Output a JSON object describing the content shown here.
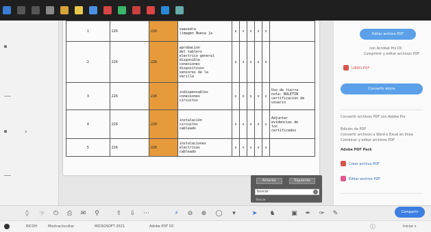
{
  "taskbar": {
    "icons": [
      "windows-icon",
      "search-icon",
      "task-view-icon",
      "app-icon",
      "app-icon",
      "folder-icon",
      "app-icon",
      "app-icon",
      "chrome-icon",
      "app-icon",
      "app-icon",
      "app-icon",
      "app-icon"
    ],
    "colors": [
      "#3a7bd5",
      "#555555",
      "#555555",
      "#888888",
      "#d6a23a",
      "#e8c84a",
      "#4a90e2",
      "#d64545",
      "#3bb56b",
      "#c94040",
      "#d44",
      "#2a8ad8",
      "#6aa"
    ]
  },
  "table": {
    "rows": [
      {
        "num": "1",
        "code": "226",
        "mid": "226",
        "desc": "saavedra\n(imagen Nueva [a",
        "marks": [
          "x",
          "x",
          "x",
          "x",
          "x"
        ],
        "note": ""
      },
      {
        "num": "2",
        "code": "226",
        "mid": "226",
        "desc": "aprobación\ndel tablero\nelectrico general\ndisponible\nconexiones\ndispositivos\nsensores de la\nvarilla",
        "marks": [
          "x",
          "x",
          "x",
          "x",
          "x"
        ],
        "note": ""
      },
      {
        "num": "3",
        "code": "226",
        "mid": "226",
        "desc": "indispensables\nconexiones\ncircuitos",
        "marks": [
          "x",
          "x",
          "x",
          "x",
          "x"
        ],
        "note": "Uso de tierra\nnota: BOLETIN\ncertificación de\nusuario"
      },
      {
        "num": "4",
        "code": "226",
        "mid": "226",
        "desc": "instalación\ncircuitos\ncableado",
        "marks": [
          "x",
          "x",
          "x",
          "x",
          "x"
        ],
        "note": "Adjuntar\nevidencias de\nlos\ncertificados"
      },
      {
        "num": "5",
        "code": "226",
        "mid": "226",
        "desc": "instalaciones\nelectricas\ncableado",
        "marks": [
          "x",
          "x",
          "x",
          "x",
          "x"
        ],
        "note": ""
      }
    ]
  },
  "popup": {
    "btn_left": "Anterior",
    "btn_right": "Siguiente",
    "input_value": "buscar",
    "footer": "Buscar"
  },
  "right_panel": {
    "top_button": "Editar archivo PDF",
    "text_1": "con Acrobat Pro DC",
    "text_2": "Comprimir y editar archivos PDF",
    "file_label": "LIBRO.PDF",
    "convert_button": "Convertir ahora",
    "promo_1": "Convertir archivos PDF con Adobe Pro",
    "promo_2": "Edición de PDF",
    "promo_3": "Convertir archivos a Word o Excel en línea",
    "promo_4": "Combinar y editar archivos PDF",
    "section_title": "Adobe PDF Pack",
    "link_1": "Crear archivo PDF",
    "link_2": "Editar archivo PDF"
  },
  "toolbar": {
    "share_label": "Compartir"
  },
  "statusbar": {
    "item_1": "RICOH",
    "item_2": "Mostrar/ocultar",
    "item_3": "MICROSOFT 2021",
    "item_4": "Adobe PDF DC",
    "right_label": "Iniciar s"
  }
}
